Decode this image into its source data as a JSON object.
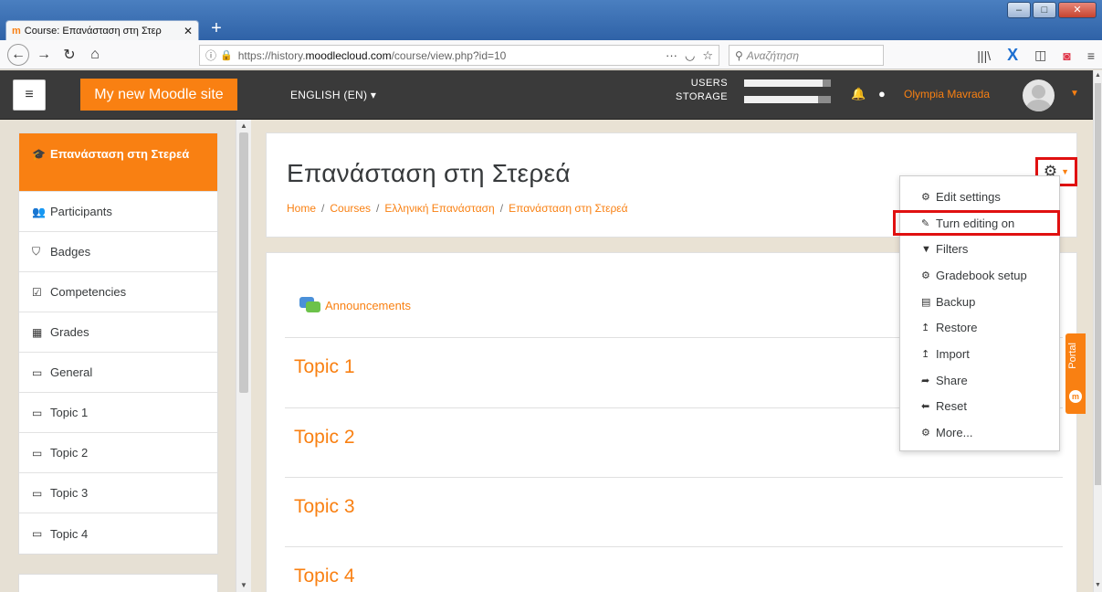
{
  "browser": {
    "tab_title": "Course: Επανάσταση στη Στερ",
    "tab_close": "✕",
    "new_tab": "+",
    "url_prefix": "https://history.",
    "url_host": "moodlecloud.com",
    "url_path": "/course/view.php?id=10",
    "url_more": "···",
    "search_placeholder": "Αναζήτηση"
  },
  "moodle": {
    "menu_icon": "hamburger-icon",
    "site_name": "My new Moodle site",
    "language": "ENGLISH (EN) ▾",
    "storage_line1": "USERS",
    "storage_line2": "STORAGE",
    "users_usage": 0.9,
    "storage_usage": 0.85,
    "username": "Olympia Mavrada"
  },
  "drawer": {
    "active_course": "Επανάσταση στη Στερεά",
    "items": [
      {
        "label": "Participants",
        "icon": "users-icon"
      },
      {
        "label": "Badges",
        "icon": "shield-icon"
      },
      {
        "label": "Competencies",
        "icon": "checkbox-icon"
      },
      {
        "label": "Grades",
        "icon": "table-icon"
      },
      {
        "label": "General",
        "icon": "folder-icon"
      },
      {
        "label": "Topic 1",
        "icon": "folder-icon"
      },
      {
        "label": "Topic 2",
        "icon": "folder-icon"
      },
      {
        "label": "Topic 3",
        "icon": "folder-icon"
      },
      {
        "label": "Topic 4",
        "icon": "folder-icon"
      }
    ]
  },
  "course": {
    "title": "Επανάσταση στη Στερεά",
    "breadcrumb": [
      "Home",
      "Courses",
      "Ελληνική Επανάσταση",
      "Επανάσταση στη Στερεά"
    ],
    "announcements": "Announcements",
    "topics": [
      "Topic 1",
      "Topic 2",
      "Topic 3",
      "Topic 4"
    ]
  },
  "menu": {
    "items": [
      {
        "label": "Edit settings",
        "icon": "gear-icon"
      },
      {
        "label": "Turn editing on",
        "icon": "pencil-icon"
      },
      {
        "label": "Filters",
        "icon": "filter-icon"
      },
      {
        "label": "Gradebook setup",
        "icon": "gear-icon"
      },
      {
        "label": "Backup",
        "icon": "file-archive-icon"
      },
      {
        "label": "Restore",
        "icon": "upload-icon"
      },
      {
        "label": "Import",
        "icon": "upload-icon"
      },
      {
        "label": "Share",
        "icon": "share-icon"
      },
      {
        "label": "Reset",
        "icon": "arrow-left-icon"
      },
      {
        "label": "More...",
        "icon": "gear-icon"
      }
    ]
  },
  "portal": {
    "label": "Portal"
  },
  "colors": {
    "accent": "#f98012",
    "navbar": "#3a3a3a",
    "highlight_border": "#e01010"
  }
}
